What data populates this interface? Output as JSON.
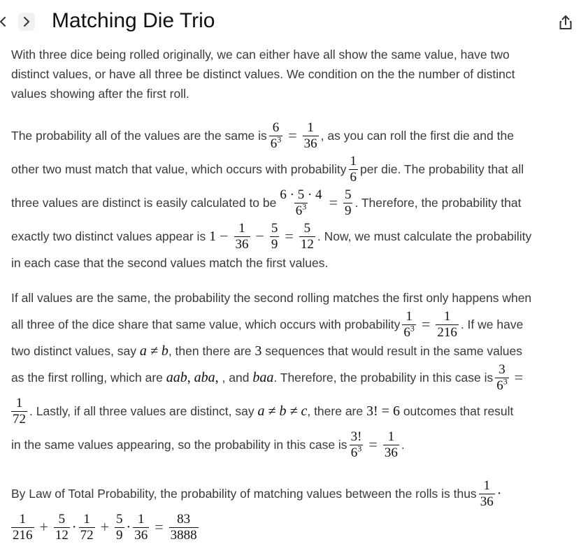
{
  "header": {
    "prev_icon": "chevron-left-icon",
    "next_icon": "chevron-right-icon",
    "title": "Matching Die Trio",
    "share_icon": "share-icon"
  },
  "p1": {
    "l1": "With three dice being rolled originally, we can either have all show the same value, have two",
    "l2": "distinct values, or have all three be distinct values. We condition on the the number of distinct",
    "l3": "values showing after the first roll."
  },
  "p2": {
    "a1": "The probability all of the values are the same is",
    "a2": ", as you can roll the first die and the",
    "b1": "other two must match that value, which occurs with probability",
    "b2": "per die. The probability that all",
    "c1": "three values are distinct is easily calculated to be",
    "c2": ". Therefore, the probability that",
    "d1": "exactly two distinct values appear is",
    "d2": ". Now, we must calculate the probability",
    "e1": "in each case that the second values match the first values."
  },
  "p3": {
    "a1": "If all values are the same, the probability the second rolling matches the first only happens when",
    "b1": "all three of the dice share that same value, which occurs with probability",
    "b2": ". If we have",
    "c1": "two distinct values, say",
    "c2": ", then there are",
    "c3": "sequences that would result in the same values",
    "d1": "as the first rolling, which are",
    "d2": ", and",
    "d3": ". Therefore, the probability in this case is",
    "e1": ". Lastly, if all three values are distinct, say",
    "e2": ", there are",
    "e3": "outcomes that result",
    "f1": "in the same values appearing, so the probability in this case is"
  },
  "p4": {
    "a1": "By Law of Total Probability, the probability of matching values between the rolls is thus"
  },
  "math": {
    "one": "1",
    "three": "3",
    "five": "5",
    "six": "6",
    "six_cubed": "6",
    "cube": "3",
    "nine": "9",
    "twelve": "12",
    "thirty_six": "36",
    "seventy_two": "72",
    "two_sixteen": "216",
    "three_bang": "3!",
    "six_five_four": "6 · 5 · 4",
    "eighty_three": "83",
    "three_eight_88": "3888",
    "a_ne_b": "a ≠ b",
    "a_ne_b_ne_c": "a ≠ b ≠ c",
    "aab": "aab",
    "aba": "aba",
    "baa": "baa",
    "eq_3bang_6": "3! = 6",
    "minus": "−",
    "eq": "=",
    "plus": "+",
    "cdot": "·",
    "comma": ","
  }
}
